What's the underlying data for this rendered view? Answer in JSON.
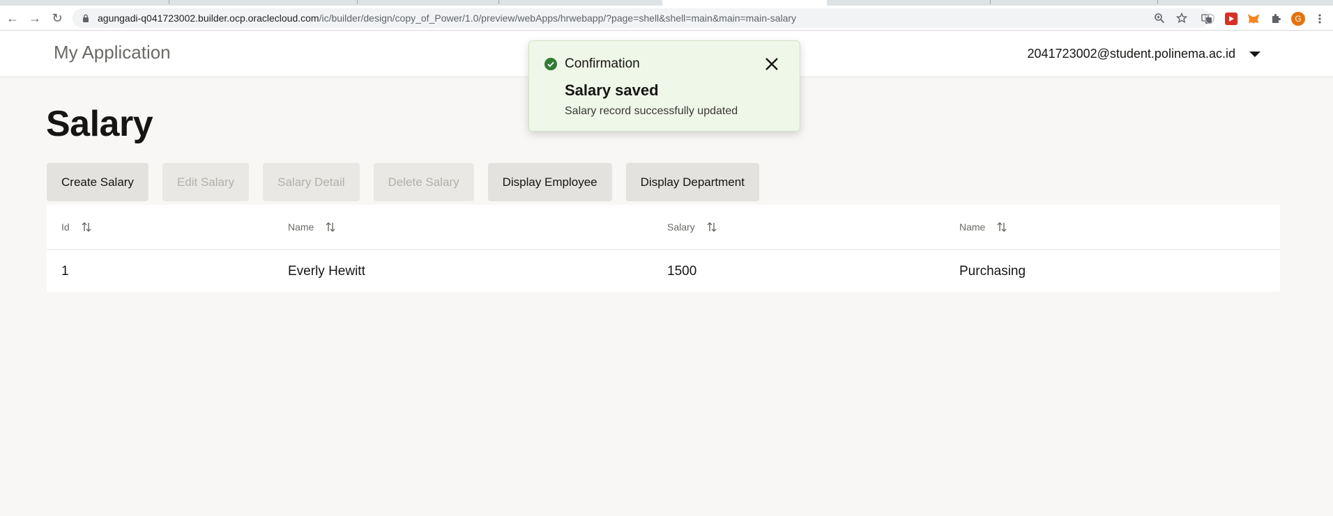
{
  "browser": {
    "url_host": "agungadi-q041723002.builder.ocp.oraclecloud.com",
    "url_path": "/ic/builder/design/copy_of_Power/1.0/preview/webApps/hrwebapp/?page=shell&shell=main&main=main-salary",
    "nav": {
      "back_icon": "←",
      "forward_icon": "→",
      "reload_icon": "↻"
    },
    "icons": [
      "translate-icon",
      "zoom-icon",
      "bookmark-star-icon",
      "shield-extension-icon",
      "video-extension-icon",
      "metamask-extension-icon",
      "extensions-puzzle-icon",
      "profile-avatar",
      "menu-icon"
    ],
    "profile_initial": "G",
    "colors": {
      "profile": "#e8710a",
      "video_ext": "#d93025",
      "metamask": "#f6851b"
    }
  },
  "header": {
    "app_title": "My Application",
    "user_email": "2041723002@student.polinema.ac.id"
  },
  "page": {
    "title": "Salary",
    "buttons": [
      {
        "label": "Create Salary",
        "enabled": true
      },
      {
        "label": "Edit Salary",
        "enabled": false
      },
      {
        "label": "Salary Detail",
        "enabled": false
      },
      {
        "label": "Delete Salary",
        "enabled": false
      },
      {
        "label": "Display Employee",
        "enabled": true
      },
      {
        "label": "Display Department",
        "enabled": true
      }
    ]
  },
  "table": {
    "columns": [
      "Id",
      "Name",
      "Salary",
      "Name"
    ],
    "rows": [
      [
        "1",
        "Everly Hewitt",
        "1500",
        "Purchasing"
      ]
    ]
  },
  "toast": {
    "kind": "Confirmation",
    "title": "Salary saved",
    "message": "Salary record successfully updated",
    "accent_color": "#2e7d32",
    "background": "#eef7e8"
  }
}
